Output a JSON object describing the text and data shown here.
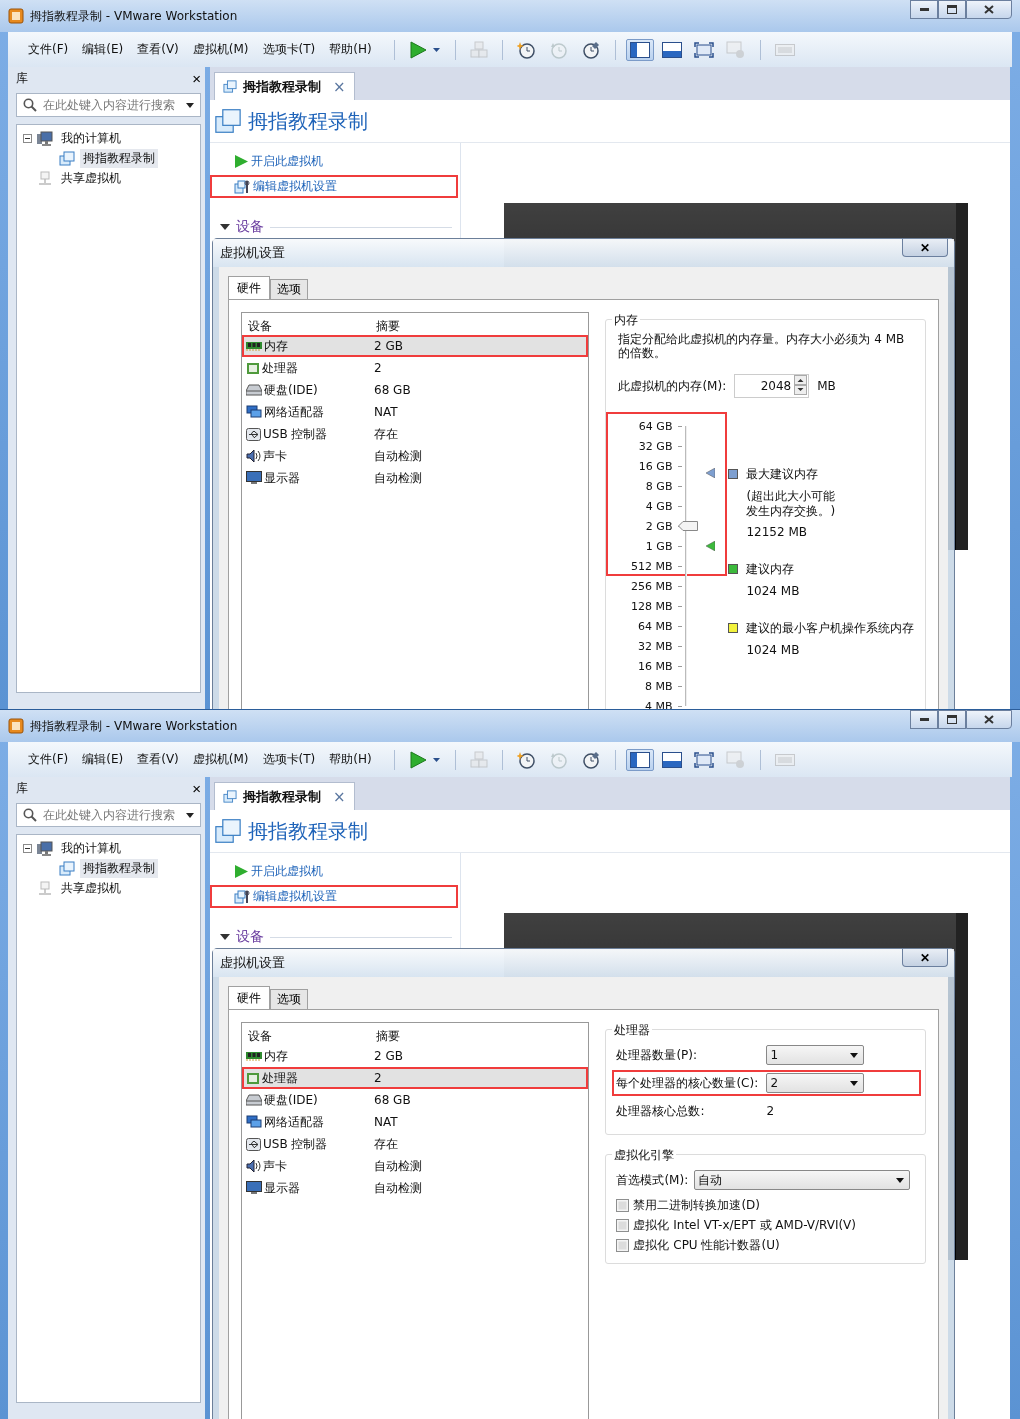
{
  "panels": [
    {
      "window": {
        "title": "拇指教程录制 - VMware Workstation"
      },
      "menu": [
        "文件(F)",
        "编辑(E)",
        "查看(V)",
        "虚拟机(M)",
        "选项卡(T)",
        "帮助(H)"
      ],
      "toolbar": [
        {
          "kind": "play",
          "disabled": false,
          "selected": false
        },
        {
          "kind": "separator"
        },
        {
          "kind": "stack",
          "disabled": true,
          "selected": false
        },
        {
          "kind": "separator"
        },
        {
          "kind": "clock-new",
          "disabled": false,
          "selected": false
        },
        {
          "kind": "clock-revert",
          "disabled": true,
          "selected": false
        },
        {
          "kind": "clock-manage",
          "disabled": false,
          "selected": false
        },
        {
          "kind": "separator"
        },
        {
          "kind": "panel-left",
          "disabled": false,
          "selected": true
        },
        {
          "kind": "panel-bottom",
          "disabled": false,
          "selected": false
        },
        {
          "kind": "fullscreen",
          "disabled": false,
          "selected": false
        },
        {
          "kind": "window-info",
          "disabled": true,
          "selected": false
        },
        {
          "kind": "separator"
        },
        {
          "kind": "window",
          "disabled": true,
          "selected": false
        }
      ],
      "library": {
        "title": "库",
        "close": "×",
        "search_placeholder": "在此处键入内容进行搜索",
        "tree": [
          {
            "label": "我的计算机",
            "kind": "computer",
            "expanded": true,
            "selected": false,
            "children": [
              {
                "label": "拇指教程录制",
                "kind": "vm",
                "selected": true
              }
            ]
          },
          {
            "label": "共享虚拟机",
            "kind": "shared",
            "selected": false
          }
        ]
      },
      "tab": {
        "label": "拇指教程录制",
        "close": "×"
      },
      "vm_title": "拇指教程录制",
      "actions": [
        {
          "label": "开启此虚拟机",
          "kind": "play",
          "highlighted": false
        },
        {
          "label": "编辑虚拟机设置",
          "kind": "settings",
          "highlighted": true
        }
      ],
      "section": {
        "label": "设备",
        "expanded": true
      },
      "dialog": {
        "title": "虚拟机设置",
        "close": "✕",
        "tabs": [
          {
            "label": "硬件",
            "selected": true
          },
          {
            "label": "选项",
            "selected": false
          }
        ],
        "columns": [
          "设备",
          "摘要"
        ],
        "devices": [
          {
            "kind": "memory",
            "name": "内存",
            "summary": "2 GB",
            "selected": true,
            "highlighted": true
          },
          {
            "kind": "cpu",
            "name": "处理器",
            "summary": "2",
            "selected": false,
            "highlighted": false
          },
          {
            "kind": "disk",
            "name": "硬盘(IDE)",
            "summary": "68 GB",
            "selected": false,
            "highlighted": false
          },
          {
            "kind": "network",
            "name": "网络适配器",
            "summary": "NAT",
            "selected": false,
            "highlighted": false
          },
          {
            "kind": "usb",
            "name": "USB 控制器",
            "summary": "存在",
            "selected": false,
            "highlighted": false
          },
          {
            "kind": "sound",
            "name": "声卡",
            "summary": "自动检测",
            "selected": false,
            "highlighted": false
          },
          {
            "kind": "display",
            "name": "显示器",
            "summary": "自动检测",
            "selected": false,
            "highlighted": false
          }
        ],
        "settings": {
          "kind": "memory",
          "title": "内存",
          "description": "指定分配给此虚拟机的内存量。内存大小必须为 4 MB 的倍数。",
          "field": {
            "label": "此虚拟机的内存(M):",
            "value": "2048",
            "unit": "MB"
          },
          "scale": {
            "highlighted_ticks": [
              "64 GB",
              "32 GB",
              "16 GB",
              "8 GB",
              "4 GB",
              "2 GB",
              "1 GB",
              "512 MB"
            ],
            "ticks": [
              "256 MB",
              "128 MB",
              "64 MB",
              "32 MB",
              "16 MB",
              "8 MB",
              "4 MB"
            ],
            "level": 0.643
          },
          "legend": [
            {
              "label": "最大建议内存",
              "note": [
                "(超出此大小可能",
                "发生内存交换。)"
              ],
              "value": "12152 MB",
              "color": "#7e9fd0",
              "level": 0.832
            },
            {
              "label": "建议内存",
              "value": "1024 MB",
              "color": "#3cba3c",
              "level": 0.571
            },
            {
              "label": "建议的最小客户机操作系统内存",
              "value": "1024 MB",
              "color": "#f2f23c"
            }
          ]
        }
      }
    },
    {
      "window": {
        "title": "拇指教程录制 - VMware Workstation"
      },
      "menu": [
        "文件(F)",
        "编辑(E)",
        "查看(V)",
        "虚拟机(M)",
        "选项卡(T)",
        "帮助(H)"
      ],
      "toolbar": [
        {
          "kind": "play",
          "disabled": false,
          "selected": false
        },
        {
          "kind": "separator"
        },
        {
          "kind": "stack",
          "disabled": true,
          "selected": false
        },
        {
          "kind": "separator"
        },
        {
          "kind": "clock-new",
          "disabled": false,
          "selected": false
        },
        {
          "kind": "clock-revert",
          "disabled": true,
          "selected": false
        },
        {
          "kind": "clock-manage",
          "disabled": false,
          "selected": false
        },
        {
          "kind": "separator"
        },
        {
          "kind": "panel-left",
          "disabled": false,
          "selected": true
        },
        {
          "kind": "panel-bottom",
          "disabled": false,
          "selected": false
        },
        {
          "kind": "fullscreen",
          "disabled": false,
          "selected": false
        },
        {
          "kind": "window-info",
          "disabled": true,
          "selected": false
        },
        {
          "kind": "separator"
        },
        {
          "kind": "window",
          "disabled": true,
          "selected": false
        }
      ],
      "library": {
        "title": "库",
        "close": "×",
        "search_placeholder": "在此处键入内容进行搜索",
        "tree": [
          {
            "label": "我的计算机",
            "kind": "computer",
            "expanded": true,
            "selected": false,
            "children": [
              {
                "label": "拇指教程录制",
                "kind": "vm",
                "selected": true
              }
            ]
          },
          {
            "label": "共享虚拟机",
            "kind": "shared",
            "selected": false
          }
        ]
      },
      "tab": {
        "label": "拇指教程录制",
        "close": "×"
      },
      "vm_title": "拇指教程录制",
      "actions": [
        {
          "label": "开启此虚拟机",
          "kind": "play",
          "highlighted": false
        },
        {
          "label": "编辑虚拟机设置",
          "kind": "settings",
          "highlighted": true
        }
      ],
      "section": {
        "label": "设备",
        "expanded": true
      },
      "dialog": {
        "title": "虚拟机设置",
        "close": "✕",
        "tabs": [
          {
            "label": "硬件",
            "selected": true
          },
          {
            "label": "选项",
            "selected": false
          }
        ],
        "columns": [
          "设备",
          "摘要"
        ],
        "devices": [
          {
            "kind": "memory",
            "name": "内存",
            "summary": "2 GB",
            "selected": false,
            "highlighted": false
          },
          {
            "kind": "cpu",
            "name": "处理器",
            "summary": "2",
            "selected": true,
            "highlighted": true
          },
          {
            "kind": "disk",
            "name": "硬盘(IDE)",
            "summary": "68 GB",
            "selected": false,
            "highlighted": false
          },
          {
            "kind": "network",
            "name": "网络适配器",
            "summary": "NAT",
            "selected": false,
            "highlighted": false
          },
          {
            "kind": "usb",
            "name": "USB 控制器",
            "summary": "存在",
            "selected": false,
            "highlighted": false
          },
          {
            "kind": "sound",
            "name": "声卡",
            "summary": "自动检测",
            "selected": false,
            "highlighted": false
          },
          {
            "kind": "display",
            "name": "显示器",
            "summary": "自动检测",
            "selected": false,
            "highlighted": false
          }
        ],
        "settings": {
          "kind": "processor",
          "groups": [
            {
              "title": "处理器",
              "rows": [
                {
                  "kind": "select",
                  "label": "处理器数量(P):",
                  "value": "1",
                  "highlighted": false
                },
                {
                  "kind": "select",
                  "label": "每个处理器的核心数量(C):",
                  "value": "2",
                  "highlighted": true
                },
                {
                  "kind": "text",
                  "label": "处理器核心总数:",
                  "value": "2",
                  "highlighted": false
                }
              ]
            },
            {
              "title": "虚拟化引擎",
              "rows": [
                {
                  "kind": "select",
                  "label": "首选模式(M):",
                  "value": "自动",
                  "highlighted": false
                },
                {
                  "kind": "checkbox",
                  "label": "禁用二进制转换加速(D)",
                  "checked": false
                },
                {
                  "kind": "checkbox",
                  "label": "虚拟化 Intel VT-x/EPT 或 AMD-V/RVI(V)",
                  "checked": false
                },
                {
                  "kind": "checkbox",
                  "label": "虚拟化 CPU 性能计数器(U)",
                  "checked": false
                }
              ]
            }
          ]
        }
      }
    }
  ]
}
